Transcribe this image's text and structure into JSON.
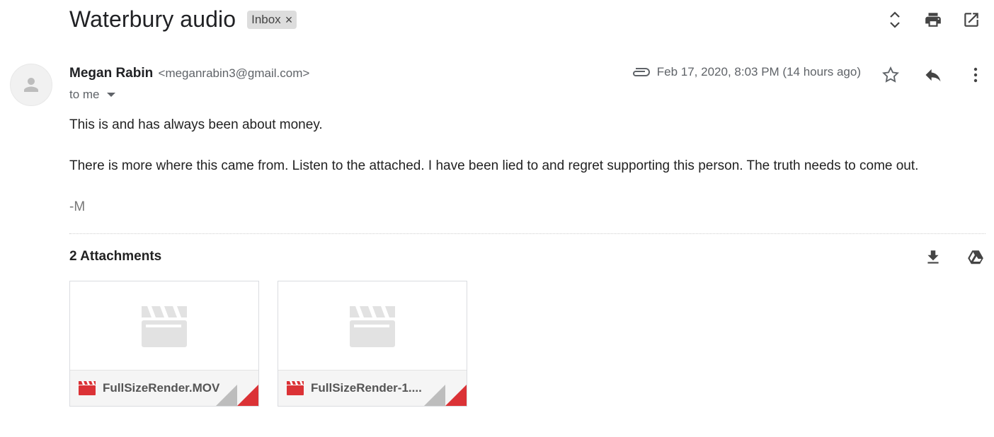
{
  "header": {
    "subject": "Waterbury audio",
    "label": "Inbox",
    "label_remove": "×",
    "icons": [
      "expand-collapse-icon",
      "print-icon",
      "open-in-new-window-icon"
    ]
  },
  "message": {
    "sender_name": "Megan Rabin",
    "sender_email": "<meganrabin3@gmail.com>",
    "recipient": "to me",
    "timestamp": "Feb 17, 2020, 8:03 PM (14 hours ago)",
    "body": [
      "This is and has always been about money.",
      "There is more where this came from. Listen to the attached. I have been lied to and regret supporting this person. The truth needs to come out.",
      "-M"
    ]
  },
  "attachments": {
    "title": "2 Attachments",
    "items": [
      {
        "name": "FullSizeRender.MOV"
      },
      {
        "name": "FullSizeRender-1...."
      }
    ]
  },
  "colors": {
    "video_icon_red": "#db3236",
    "placeholder_gray": "#e2e2e2",
    "icon_gray": "#444444"
  }
}
